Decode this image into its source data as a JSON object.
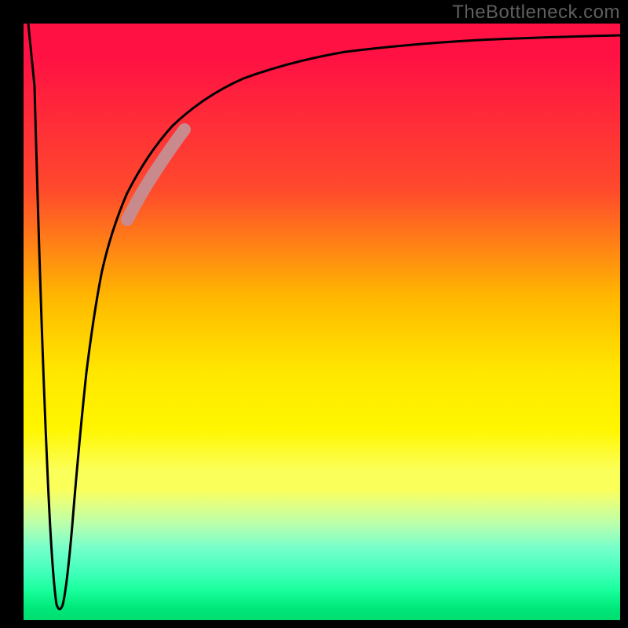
{
  "watermark": "TheBottleneck.com",
  "chart_data": {
    "type": "line",
    "title": "",
    "xlabel": "",
    "ylabel": "",
    "xlim": [
      0,
      100
    ],
    "ylim": [
      0,
      100
    ],
    "grid": false,
    "series": [
      {
        "name": "bottleneck-curve",
        "x": [
          0,
          4,
          5,
          6,
          7,
          8,
          10,
          12,
          15,
          18,
          22,
          27,
          33,
          40,
          50,
          62,
          78,
          100
        ],
        "y": [
          100,
          50,
          10,
          0,
          10,
          30,
          50,
          60,
          70,
          78,
          83,
          87,
          90,
          92,
          94,
          95.5,
          96.5,
          97.5
        ]
      }
    ],
    "annotations": [
      {
        "name": "highlight-segment",
        "x_range": [
          17,
          25
        ],
        "color": "#c98a8e"
      }
    ],
    "gradient_stops": [
      {
        "pos": 0,
        "color": "#ff1243"
      },
      {
        "pos": 50,
        "color": "#ffe600"
      },
      {
        "pos": 80,
        "color": "#fbff5a"
      },
      {
        "pos": 100,
        "color": "#00dd70"
      }
    ]
  }
}
